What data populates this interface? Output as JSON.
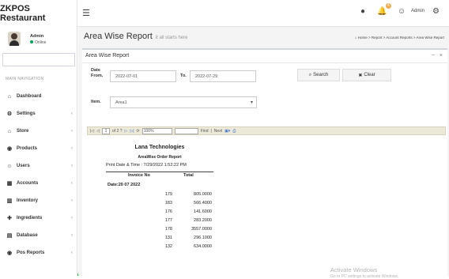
{
  "app": {
    "brand": "ZKPOS Restaurant",
    "menu_icon": "☰",
    "user_name": "Admin",
    "user_status": "Online",
    "notif_count": "4"
  },
  "sidebar": {
    "header": "MAIN NAVIGATION",
    "items": [
      {
        "label": "Dashboard",
        "icon": "dashboard-icon",
        "glyph": "⌂",
        "has_children": false
      },
      {
        "label": "Settings",
        "icon": "gear-icon",
        "glyph": "⚙",
        "has_children": true
      },
      {
        "label": "Store",
        "icon": "store-icon",
        "glyph": "⌂",
        "has_children": true
      },
      {
        "label": "Products",
        "icon": "products-icon",
        "glyph": "◉",
        "has_children": true
      },
      {
        "label": "Users",
        "icon": "user-icon",
        "glyph": "☺",
        "has_children": true
      },
      {
        "label": "Accounts",
        "icon": "accounts-icon",
        "glyph": "▦",
        "has_children": true
      },
      {
        "label": "Inventory",
        "icon": "inventory-icon",
        "glyph": "▥",
        "has_children": true
      },
      {
        "label": "Ingredients",
        "icon": "ingredients-icon",
        "glyph": "✚",
        "has_children": true
      },
      {
        "label": "Database",
        "icon": "database-icon",
        "glyph": "▤",
        "has_children": true
      },
      {
        "label": "Pos Reports",
        "icon": "eye-icon",
        "glyph": "◉",
        "has_children": true
      }
    ]
  },
  "page": {
    "title": "Area Wise Report",
    "subtitle": "it all starts here"
  },
  "breadcrumb": [
    "Home",
    "Report",
    "Account Reports",
    "Area Wise Report"
  ],
  "panel": {
    "title": "Area Wise Report",
    "tools": "− ×"
  },
  "form": {
    "date_from_label": "Date From.",
    "date_from_value": "2022-07-01",
    "to_label": "To.",
    "to_value": "2022-07-29",
    "item_label": "Item.",
    "item_value": "Area1",
    "search_label": "Search",
    "clear_label": "Clear"
  },
  "toolbar": {
    "first": "|◁",
    "prev": "◁",
    "page": "1",
    "of_text": "of 2 ?",
    "next": "▷",
    "last": "▷|",
    "zoom": "100%",
    "find": "Find",
    "next_find": "Next"
  },
  "report": {
    "company": "Lana Technologies",
    "title": "AreaWise Order Report",
    "print_date": "Print Date & Time : 7/29/2022 1:52:22 PM",
    "col_invoice": "Invoice No",
    "col_total": "Total",
    "date_group": "Date:20 07 2022",
    "rows": [
      {
        "invoice": "179",
        "total": "805.0000"
      },
      {
        "invoice": "183",
        "total": "566.4000"
      },
      {
        "invoice": "176",
        "total": "141.6000"
      },
      {
        "invoice": "177",
        "total": "283.2000"
      },
      {
        "invoice": "178",
        "total": "3557.0000"
      },
      {
        "invoice": "131",
        "total": "296.1000"
      },
      {
        "invoice": "132",
        "total": "634.0000"
      }
    ]
  },
  "watermark": {
    "line1": "Activate Windows",
    "line2": "Go to PC settings to activate Windows."
  }
}
